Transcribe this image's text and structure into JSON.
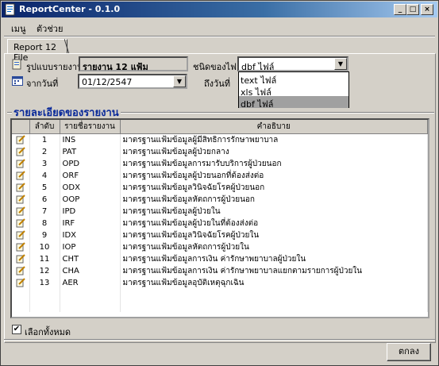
{
  "window": {
    "title": "ReportCenter - 0.1.0"
  },
  "menu": {
    "items": [
      "เมนู",
      "ตัวช่วย"
    ]
  },
  "tab": {
    "label": "Report 12 File"
  },
  "form": {
    "report_format_label": "รูปแบบรายงาน",
    "report_format_value": "รายงาน 12 แฟ้ม",
    "file_type_label": "ชนิดของไฟล์",
    "file_type_value": "dbf ไฟล์",
    "file_type_options": [
      "text ไฟล์",
      "xls ไฟล์",
      "dbf ไฟล์"
    ],
    "from_date_label": "จากวันที่",
    "from_date_value": "01/12/2547",
    "to_date_label": "ถึงวันที่"
  },
  "details": {
    "title": "รายละเอียดของรายงาน",
    "columns": [
      "ลำดับ",
      "รายชื่อรายงาน",
      "คำอธิบาย"
    ],
    "rows": [
      [
        "1",
        "INS",
        "มาตรฐานแฟ้มข้อมูลผู้มีสิทธิการรักษาพยาบาล"
      ],
      [
        "2",
        "PAT",
        "มาตรฐานแฟ้มข้อมูลผู้ป่วยกลาง"
      ],
      [
        "3",
        "OPD",
        "มาตรฐานแฟ้มข้อมูลการมารับบริการผู้ป่วยนอก"
      ],
      [
        "4",
        "ORF",
        "มาตรฐานแฟ้มข้อมูลผู้ป่วยนอกที่ต้องส่งต่อ"
      ],
      [
        "5",
        "ODX",
        "มาตรฐานแฟ้มข้อมูลวินิจฉัยโรคผู้ป่วยนอก"
      ],
      [
        "6",
        "OOP",
        "มาตรฐานแฟ้มข้อมูลหัตถการผู้ป่วยนอก"
      ],
      [
        "7",
        "IPD",
        "มาตรฐานแฟ้มข้อมูลผู้ป่วยใน"
      ],
      [
        "8",
        "IRF",
        "มาตรฐานแฟ้มข้อมูลผู้ป่วยในที่ต้องส่งต่อ"
      ],
      [
        "9",
        "IDX",
        "มาตรฐานแฟ้มข้อมูลวินิจฉัยโรคผู้ป่วยใน"
      ],
      [
        "10",
        "IOP",
        "มาตรฐานแฟ้มข้อมูลหัตถการผู้ป่วยใน"
      ],
      [
        "11",
        "CHT",
        "มาตรฐานแฟ้มข้อมูลการเงิน ค่ารักษาพยาบาลผู้ป่วยใน"
      ],
      [
        "12",
        "CHA",
        "มาตรฐานแฟ้มข้อมูลการเงิน ค่ารักษาพยาบาลแยกตามรายการผู้ป่วยใน"
      ],
      [
        "13",
        "AER",
        "มาตรฐานแฟ้มข้อมูลอุบัติเหตุฉุกเฉิน"
      ]
    ]
  },
  "select_all": {
    "label": "เลือกทั้งหมด",
    "checked": true
  },
  "ok_button": {
    "label": "ตกลง"
  }
}
